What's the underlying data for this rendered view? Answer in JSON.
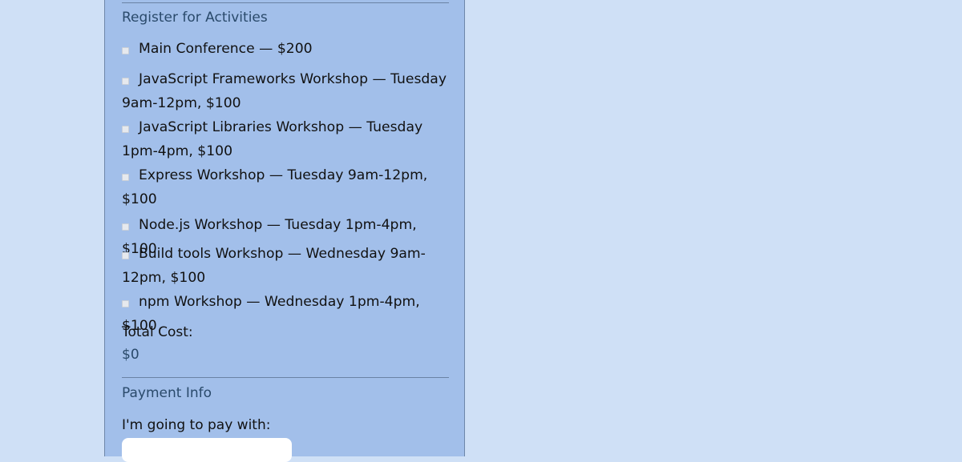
{
  "activities": {
    "legend": "Register for Activities",
    "items": [
      {
        "label": "Main Conference — $200",
        "checked": false
      },
      {
        "label": "JavaScript Frameworks Workshop — Tuesday 9am-12pm, $100",
        "checked": false
      },
      {
        "label": "JavaScript Libraries Workshop — Tuesday 1pm-4pm, $100",
        "checked": false
      },
      {
        "label": "Express Workshop — Tuesday 9am-12pm, $100",
        "checked": false
      },
      {
        "label": "Node.js Workshop — Tuesday 1pm-4pm, $100",
        "checked": false
      },
      {
        "label": "Build tools Workshop — Wednesday 9am-12pm, $100",
        "checked": false
      },
      {
        "label": "npm Workshop — Wednesday 1pm-4pm, $100",
        "checked": false
      }
    ],
    "total_label": "Total Cost:",
    "total_value": "$0"
  },
  "payment": {
    "legend": "Payment Info",
    "pay_with_label": "I'm going to pay with:"
  },
  "colors": {
    "page_background": "#cfe0f6",
    "panel_background": "#a2bfea",
    "legend_text": "#2a4a6b"
  }
}
